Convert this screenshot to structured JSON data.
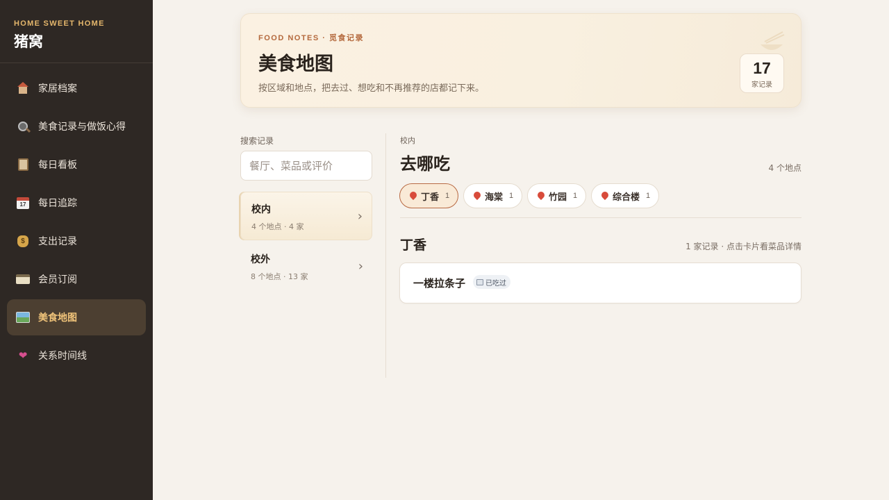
{
  "sidebar": {
    "brand_sub": "HOME SWEET HOME",
    "brand_title": "猪窝",
    "items": [
      {
        "label": "家居档案",
        "icon": "house-icon"
      },
      {
        "label": "美食记录与做饭心得",
        "icon": "frying-pan-icon"
      },
      {
        "label": "每日看板",
        "icon": "clipboard-icon"
      },
      {
        "label": "每日追踪",
        "icon": "calendar-icon"
      },
      {
        "label": "支出记录",
        "icon": "money-bag-icon"
      },
      {
        "label": "会员订阅",
        "icon": "credit-card-icon"
      },
      {
        "label": "美食地图",
        "icon": "map-icon",
        "active": true
      },
      {
        "label": "关系时间线",
        "icon": "heart-icon"
      }
    ],
    "calendar_icon_text": "17",
    "money_icon_text": "$"
  },
  "hero": {
    "eyebrow": "FOOD NOTES · 觅食记录",
    "title": "美食地图",
    "description": "按区域和地点，把去过、想吃和不再推荐的店都记下来。",
    "count": "17",
    "count_label": "家记录"
  },
  "search": {
    "label": "搜索记录",
    "placeholder": "餐厅、菜品或评价",
    "value": ""
  },
  "regions": [
    {
      "name": "校内",
      "meta": "4 个地点 · 4 家",
      "active": true
    },
    {
      "name": "校外",
      "meta": "8 个地点 · 13 家",
      "active": false
    }
  ],
  "chevron": "›",
  "main": {
    "breadcrumb": "校内",
    "title": "去哪吃",
    "place_count": "4 个地点",
    "chips": [
      {
        "label": "丁香",
        "count": "1",
        "active": true
      },
      {
        "label": "海棠",
        "count": "1"
      },
      {
        "label": "竹园",
        "count": "1"
      },
      {
        "label": "综合楼",
        "count": "1"
      }
    ],
    "section_title": "丁香",
    "section_meta": "1 家记录 · 点击卡片看菜品详情",
    "restaurants": [
      {
        "name": "一楼拉条子",
        "tag": "已吃过",
        "tag_icon": "utensils-icon"
      }
    ]
  },
  "colors": {
    "sidebar_bg": "#2e2824",
    "accent": "#f1c47a",
    "page_bg": "#f6f2ec",
    "chip_active_border": "#b86a43",
    "pin": "#d84b3b"
  }
}
